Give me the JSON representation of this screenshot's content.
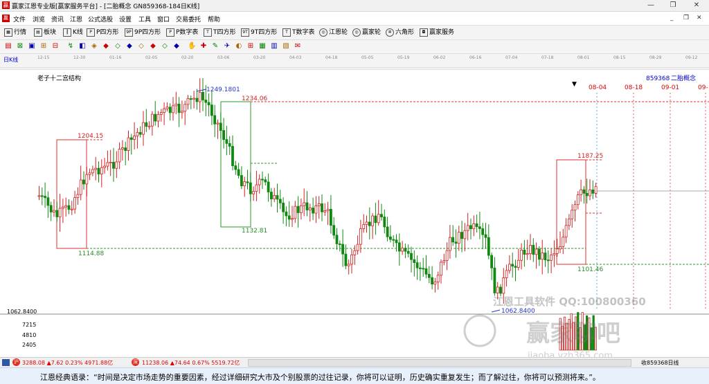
{
  "window": {
    "title": "赢家江恩专业版[赢家服务平台] - [二胎概念  GN859368-184日K线]"
  },
  "menu": [
    "文件",
    "浏览",
    "资讯",
    "江恩",
    "公式选股",
    "设置",
    "工具",
    "窗口",
    "交易委托",
    "帮助"
  ],
  "toolbar1": [
    "行情",
    "板块",
    "K线",
    "P四方形",
    "9P四方形",
    "P数字表",
    "T四方形",
    "9T四方形",
    "T数字表",
    "江恩轮",
    "赢家轮",
    "六角形",
    "赢家服务"
  ],
  "chart_header": {
    "period": "日K线",
    "title": "老子十二宫结构",
    "code": "859368",
    "name": "二胎概念"
  },
  "x_dates": [
    "12-15",
    "12-30",
    "01-16",
    "02-05",
    "02-20",
    "03-06",
    "03-20",
    "04-03",
    "04-18",
    "05-05",
    "05-19",
    "06-02",
    "06-16",
    "07-04",
    "07-18",
    "08-01",
    "08-15",
    "08-29",
    "09-12"
  ],
  "future_dates": [
    "08-04",
    "08-18",
    "09-01",
    "09-"
  ],
  "price_labels": {
    "p1249": "1249.1801",
    "p1234": "1234.06",
    "p1204": "1204.15",
    "p1187": "1187.25",
    "p1132": "1132.81",
    "p1114": "1114.88",
    "p1101": "1101.46",
    "p1062": "1062.8400",
    "axis1062": "1062.8400"
  },
  "volume_axis": [
    "7215",
    "4810",
    "2405"
  ],
  "watermark": {
    "line1": "江恩工具软件  QQ:100800360",
    "line2": "赢家聊吧",
    "line3": "jiaoba.yzh365.com"
  },
  "status": {
    "index1": "3288.08 ▲7.62 0.23% 4971.88亿",
    "index2": "11238.06 ▲74.64 0.67% 5519.72亿",
    "right": "收859368日线"
  },
  "quote": "江恩经典语录：“时间是决定市场走势的重要因素，经过详细研究大市及个别股票的过往记录，你将可以证明，历史确实重复发生；而了解过往，你将可以预测将来。”。",
  "chart_data": {
    "type": "candlestick",
    "title": "老子十二宫结构",
    "period": "日K线",
    "price_marks": [
      1249.1801,
      1234.06,
      1204.15,
      1187.25,
      1132.81,
      1114.88,
      1101.46,
      1062.84
    ],
    "ylim": [
      1062.84,
      1260
    ],
    "volume_ticks": [
      7215,
      4810,
      2405
    ]
  }
}
